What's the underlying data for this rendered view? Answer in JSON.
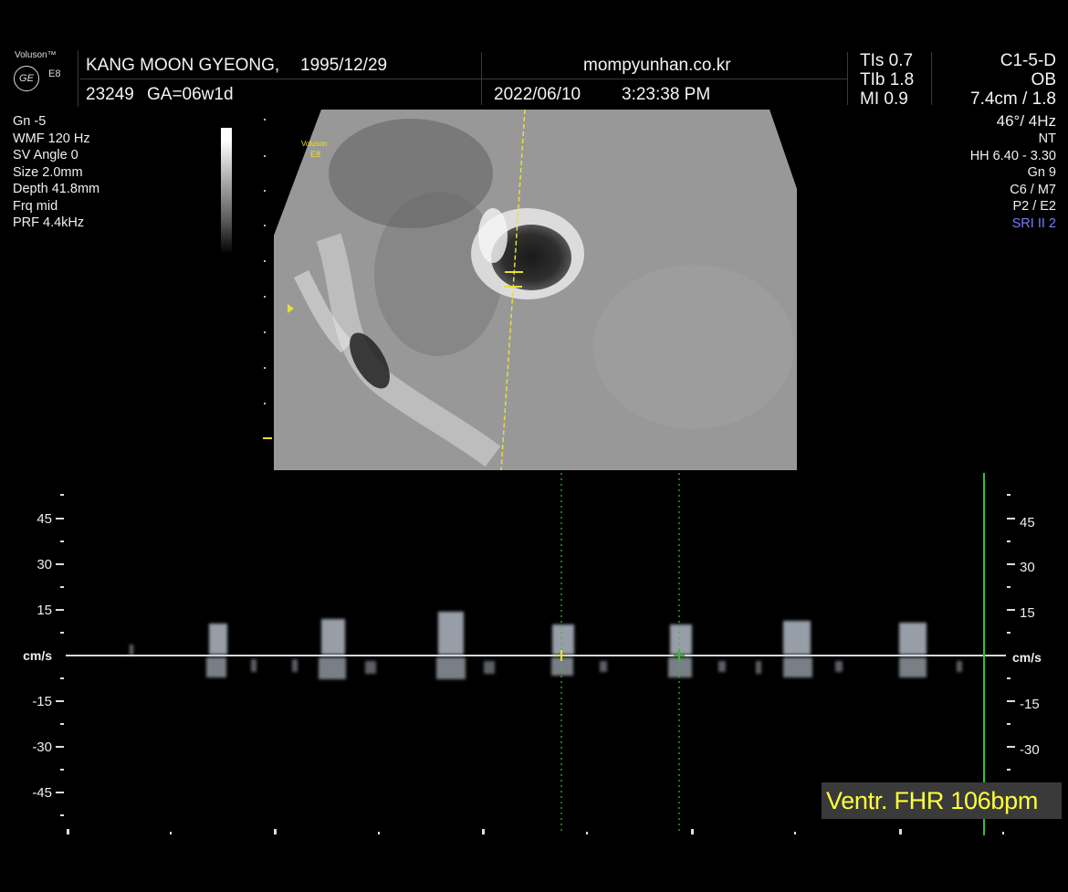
{
  "brand": {
    "name": "Voluson™",
    "model": "E8",
    "logo": "GE"
  },
  "patient": {
    "name": "KANG MOON GYEONG,",
    "dob": "1995/12/29",
    "id": "23249",
    "ga": "GA=06w1d"
  },
  "site": "mompyunhan.co.kr",
  "exam": {
    "date": "2022/06/10",
    "time": "3:23:38 PM"
  },
  "safety": {
    "tis": "TIs  0.7",
    "tib": "TIb  1.8",
    "mi": "MI  0.9"
  },
  "probe": {
    "name": "C1-5-D",
    "preset": "OB",
    "depth": "7.4cm / 1.8"
  },
  "left_params": [
    "Gn  -5",
    "WMF 120 Hz",
    "SV Angle  0",
    "Size  2.0mm",
    "Depth 41.8mm",
    "Frq mid",
    "PRF  4.4kHz"
  ],
  "right_params": [
    "46°/  4Hz",
    "NT",
    "HH  6.40 - 3.30",
    "Gn  9",
    "C6 / M7",
    "P2 / E2"
  ],
  "right_param_highlight": "SRI II 2",
  "colors": {
    "highlight": "#7a7cff",
    "measure_box": "#3a3a3a",
    "measure_text": "#ffff3c",
    "cursor_green": "#2ec42e",
    "caliper_yellow": "#e5e03a"
  },
  "image_watermark": {
    "name": "Voluson",
    "model": "E8"
  },
  "doppler_scale": {
    "unit": "cm/s",
    "ticks": [
      "45",
      "30",
      "15",
      "-15",
      "-30",
      "-45"
    ]
  },
  "measurement": "Ventr. FHR 106bpm"
}
